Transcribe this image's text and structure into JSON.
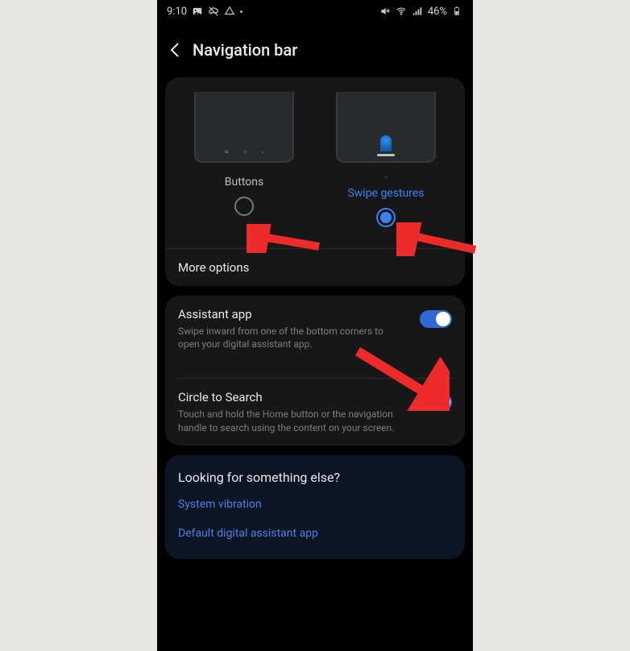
{
  "statusbar": {
    "time": "9:10",
    "battery_text": "46%"
  },
  "header": {
    "title": "Navigation bar"
  },
  "nav_type": {
    "options": [
      {
        "label": "Buttons",
        "selected": false
      },
      {
        "label": "Swipe gestures",
        "selected": true
      }
    ],
    "more_options": "More options"
  },
  "settings": [
    {
      "title": "Assistant app",
      "subtitle": "Swipe inward from one of the bottom corners to open your digital assistant app.",
      "enabled": true
    },
    {
      "title": "Circle to Search",
      "subtitle": "Touch and hold the Home button or the navigation handle to search using the content on your screen.",
      "enabled": true
    }
  ],
  "lookfor": {
    "title": "Looking for something else?",
    "links": [
      "System vibration",
      "Default digital assistant app"
    ]
  },
  "colors": {
    "accent": "#3b82f6",
    "arrow": "#ef2a2a"
  }
}
